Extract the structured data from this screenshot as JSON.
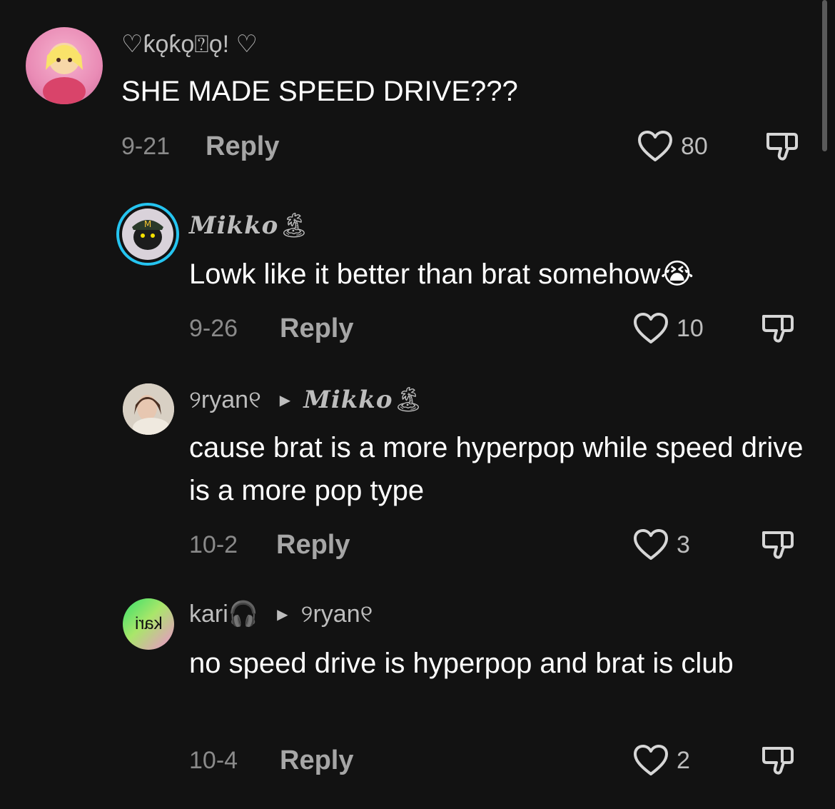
{
  "comments": [
    {
      "username": "♡ƙǫƙǫ⍰ǫ! ♡",
      "text": "SHE MADE SPEED DRIVE???",
      "date": "9-21",
      "reply_label": "Reply",
      "likes": "80"
    },
    {
      "username": "Mikko",
      "name_emoji": "🏝",
      "text": "Lowk like it better than brat somehow",
      "text_emoji": "😭",
      "date": "9-26",
      "reply_label": "Reply",
      "likes": "10"
    },
    {
      "username": "୨ryan୧",
      "reply_to": "Mikko",
      "reply_to_emoji": "🏝",
      "text": "cause brat is a more hyperpop while speed drive is a more pop type",
      "date": "10-2",
      "reply_label": "Reply",
      "likes": "3"
    },
    {
      "username": "kari",
      "name_emoji": "🎧",
      "reply_to": "୨ryan୧",
      "avatar_text": "kari",
      "text": "no speed drive is hyperpop and brat is club",
      "date": "10-4",
      "reply_label": "Reply",
      "likes": "2"
    }
  ],
  "colors": {
    "background": "#121212",
    "text_primary": "#ffffff",
    "text_secondary": "#bdbdbd",
    "date": "#8a8a8a",
    "story_ring": "#25c4f0"
  },
  "icons": [
    "heart-outline-icon",
    "thumbs-down-icon",
    "arrow-right-icon"
  ]
}
